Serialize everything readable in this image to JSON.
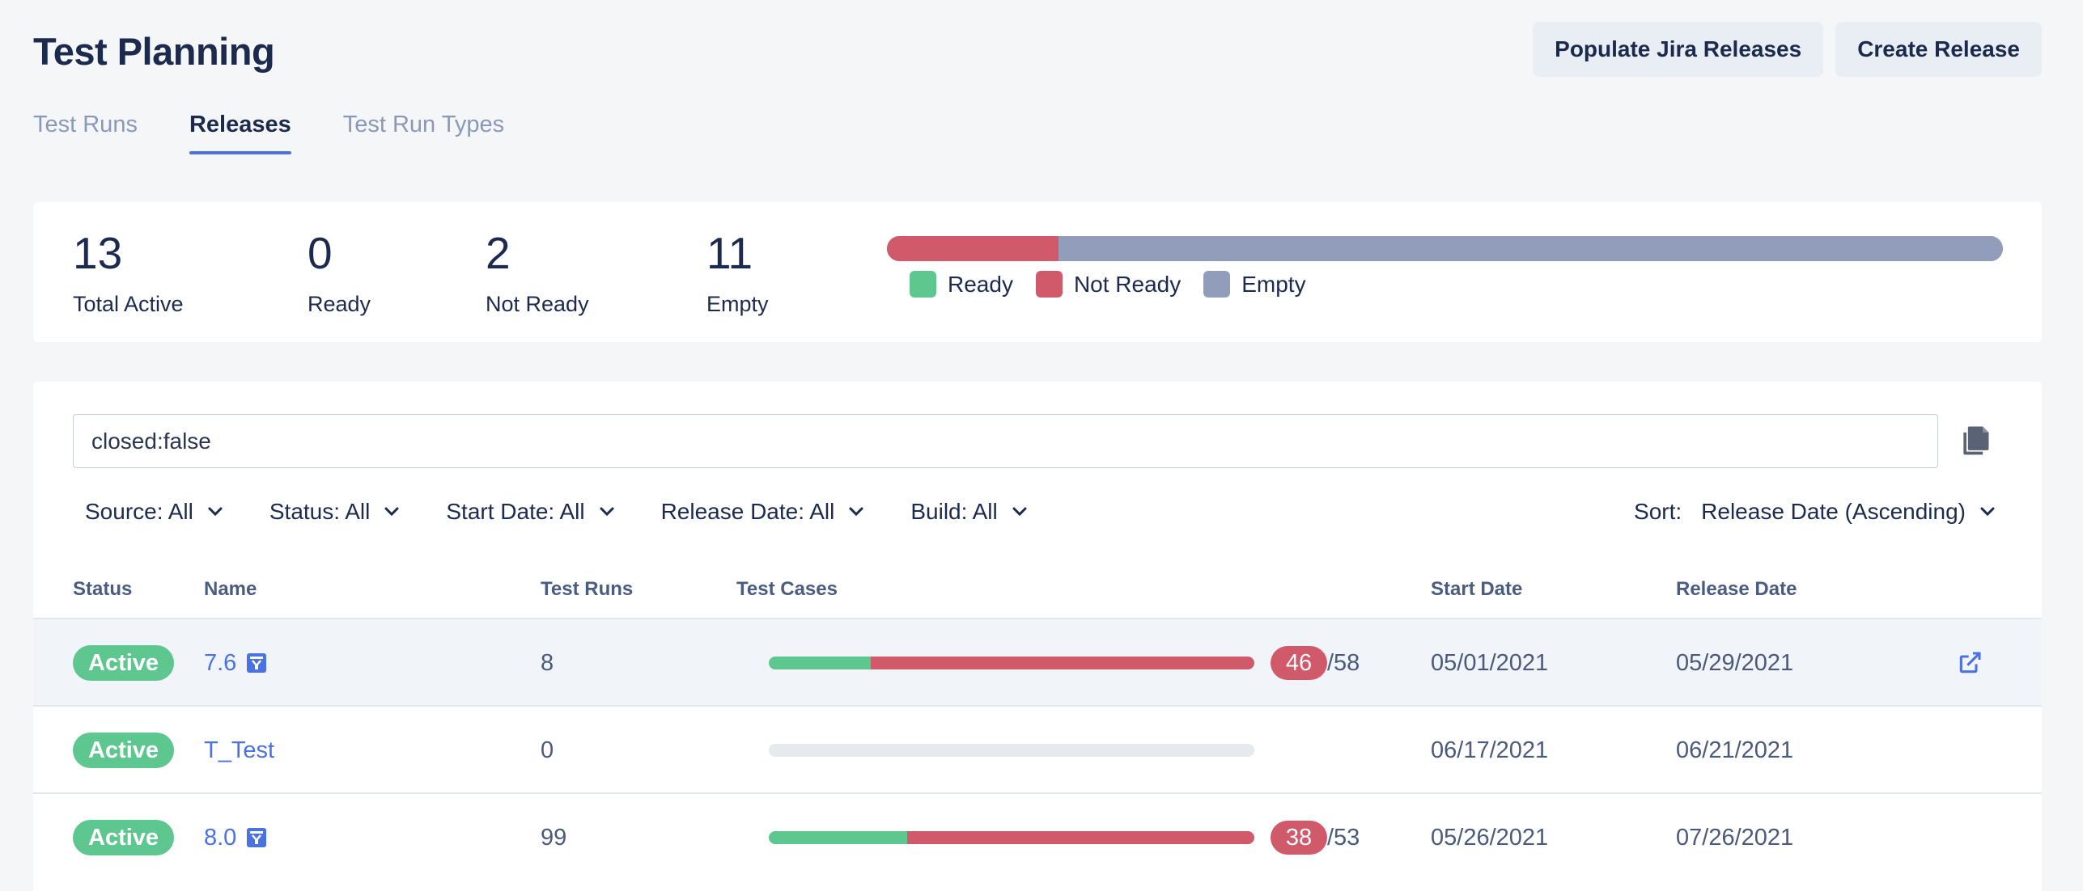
{
  "page": {
    "title": "Test Planning"
  },
  "actions": {
    "populate": "Populate Jira Releases",
    "create": "Create Release"
  },
  "tabs": [
    {
      "label": "Test Runs",
      "active": false
    },
    {
      "label": "Releases",
      "active": true
    },
    {
      "label": "Test Run Types",
      "active": false
    }
  ],
  "summary": {
    "stats": [
      {
        "value": "13",
        "label": "Total Active"
      },
      {
        "value": "0",
        "label": "Ready"
      },
      {
        "value": "2",
        "label": "Not Ready"
      },
      {
        "value": "11",
        "label": "Empty"
      }
    ],
    "bar_counts": {
      "ready": 0,
      "not_ready": 2,
      "empty": 11
    },
    "legend": [
      {
        "label": "Ready",
        "color": "#5ec78f"
      },
      {
        "label": "Not Ready",
        "color": "#d05a6a"
      },
      {
        "label": "Empty",
        "color": "#929dbb"
      }
    ]
  },
  "search": {
    "value": "closed:false",
    "copy_icon": "copy-icon"
  },
  "filters": [
    "Source: All",
    "Status: All",
    "Start Date: All",
    "Release Date: All",
    "Build: All"
  ],
  "sort": {
    "label": "Sort:",
    "value": "Release Date (Ascending)"
  },
  "columns": {
    "status": "Status",
    "name": "Name",
    "test_runs": "Test Runs",
    "test_cases": "Test Cases",
    "start_date": "Start Date",
    "release_date": "Release Date"
  },
  "rows": [
    {
      "status": "Active",
      "name": "7.6",
      "jira": true,
      "test_runs": "8",
      "passed_fraction": 0.21,
      "failed_fraction": 0.79,
      "failing": "46",
      "total": "/58",
      "start_date": "05/01/2021",
      "release_date": "05/29/2021",
      "external_link": true
    },
    {
      "status": "Active",
      "name": "T_Test",
      "jira": false,
      "test_runs": "0",
      "passed_fraction": 0,
      "failed_fraction": 0,
      "failing": "",
      "total": "",
      "start_date": "06/17/2021",
      "release_date": "06/21/2021",
      "external_link": false
    },
    {
      "status": "Active",
      "name": "8.0",
      "jira": true,
      "test_runs": "99",
      "passed_fraction": 0.285,
      "failed_fraction": 0.715,
      "failing": "38",
      "total": "/53",
      "start_date": "05/26/2021",
      "release_date": "07/26/2021",
      "external_link": false
    }
  ],
  "colors": {
    "accent": "#4a72e0",
    "ready": "#5ec78f",
    "not_ready": "#d05a6a",
    "empty": "#929dbb"
  }
}
